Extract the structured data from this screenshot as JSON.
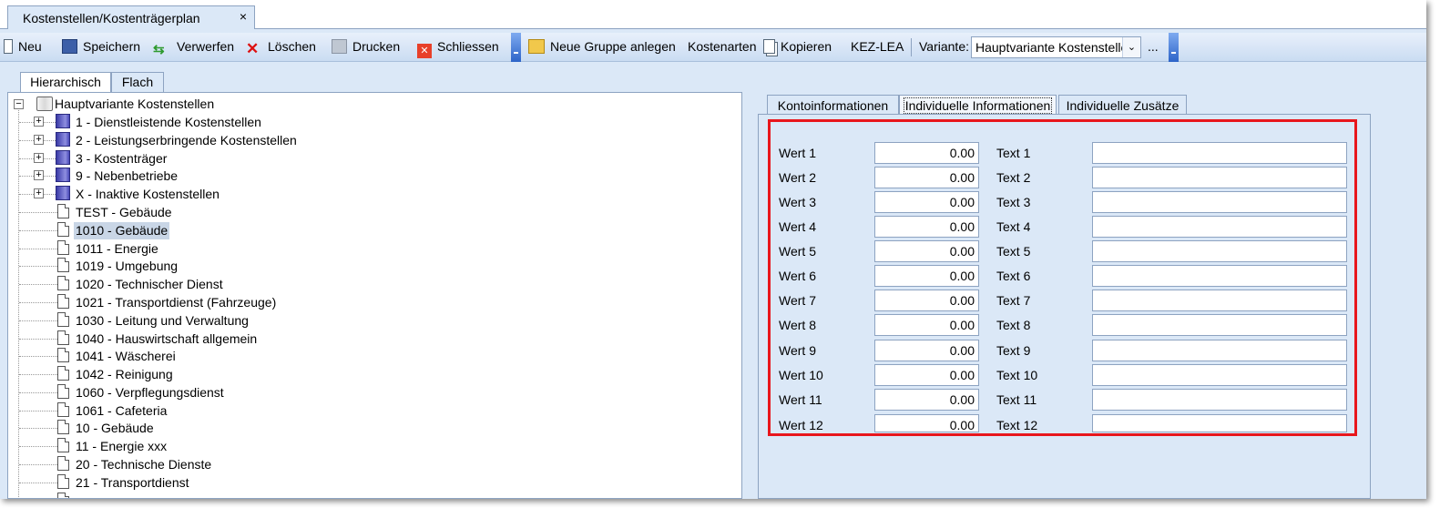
{
  "document_tab": {
    "title": "Kostenstellen/Kostenträgerplan",
    "close": "×"
  },
  "toolbar": {
    "neu": "Neu",
    "speichern": "Speichern",
    "verwerfen": "Verwerfen",
    "loeschen": "Löschen",
    "drucken": "Drucken",
    "schliessen": "Schliessen",
    "neue_gruppe": "Neue Gruppe anlegen",
    "kostenarten": "Kostenarten",
    "kopieren": "Kopieren",
    "kez_lea": "KEZ-LEA",
    "variante_label": "Variante:",
    "variante_value": "Hauptvariante Kostenstelle",
    "more": "..."
  },
  "view_tabs": {
    "hierarchisch": "Hierarchisch",
    "flach": "Flach"
  },
  "tree": {
    "root": "Hauptvariante Kostenstellen",
    "groups": [
      "1 - Dienstleistende Kostenstellen",
      "2 - Leistungserbringende Kostenstellen",
      "3 - Kostenträger",
      "9 - Nebenbetriebe",
      "X - Inaktive Kostenstellen"
    ],
    "items": [
      "TEST - Gebäude",
      "1010 - Gebäude",
      "1011 - Energie",
      "1019 - Umgebung",
      "1020 - Technischer Dienst",
      "1021 - Transportdienst (Fahrzeuge)",
      "1030 - Leitung und Verwaltung",
      "1040 - Hauswirtschaft allgemein",
      "1041 - Wäscherei",
      "1042 - Reinigung",
      "1060 - Verpflegungsdienst",
      "1061 - Cafeteria",
      "10 - Gebäude",
      "11 - Energie xxx",
      "20 - Technische Dienste",
      "21 - Transportdienst"
    ],
    "selected_item": "1010 - Gebäude"
  },
  "detail_tabs": {
    "kontoinformationen": "Kontoinformationen",
    "individuelle_informationen": "Individuelle Informationen",
    "individuelle_zusaetze": "Individuelle Zusätze",
    "active": "Individuelle Informationen"
  },
  "fields": [
    {
      "wert_label": "Wert 1",
      "wert_value": "0.00",
      "text_label": "Text 1",
      "text_value": ""
    },
    {
      "wert_label": "Wert 2",
      "wert_value": "0.00",
      "text_label": "Text 2",
      "text_value": ""
    },
    {
      "wert_label": "Wert 3",
      "wert_value": "0.00",
      "text_label": "Text 3",
      "text_value": ""
    },
    {
      "wert_label": "Wert 4",
      "wert_value": "0.00",
      "text_label": "Text 4",
      "text_value": ""
    },
    {
      "wert_label": "Wert 5",
      "wert_value": "0.00",
      "text_label": "Text 5",
      "text_value": ""
    },
    {
      "wert_label": "Wert 6",
      "wert_value": "0.00",
      "text_label": "Text 6",
      "text_value": ""
    },
    {
      "wert_label": "Wert 7",
      "wert_value": "0.00",
      "text_label": "Text 7",
      "text_value": ""
    },
    {
      "wert_label": "Wert 8",
      "wert_value": "0.00",
      "text_label": "Text 8",
      "text_value": ""
    },
    {
      "wert_label": "Wert 9",
      "wert_value": "0.00",
      "text_label": "Text 9",
      "text_value": ""
    },
    {
      "wert_label": "Wert 10",
      "wert_value": "0.00",
      "text_label": "Text 10",
      "text_value": ""
    },
    {
      "wert_label": "Wert 11",
      "wert_value": "0.00",
      "text_label": "Text 11",
      "text_value": ""
    },
    {
      "wert_label": "Wert 12",
      "wert_value": "0.00",
      "text_label": "Text 12",
      "text_value": ""
    }
  ],
  "colors": {
    "panel_bg": "#dbe8f7",
    "border": "#8da3c1",
    "highlight": "#e8161c",
    "selection": "#c9d6e6"
  },
  "icons": {
    "neu": "new-document-icon",
    "speichern": "save-icon",
    "verwerfen": "discard-icon",
    "loeschen": "delete-x-icon",
    "drucken": "print-icon",
    "schliessen": "close-icon",
    "neue_gruppe": "new-folder-icon",
    "kopieren": "copy-icon"
  }
}
